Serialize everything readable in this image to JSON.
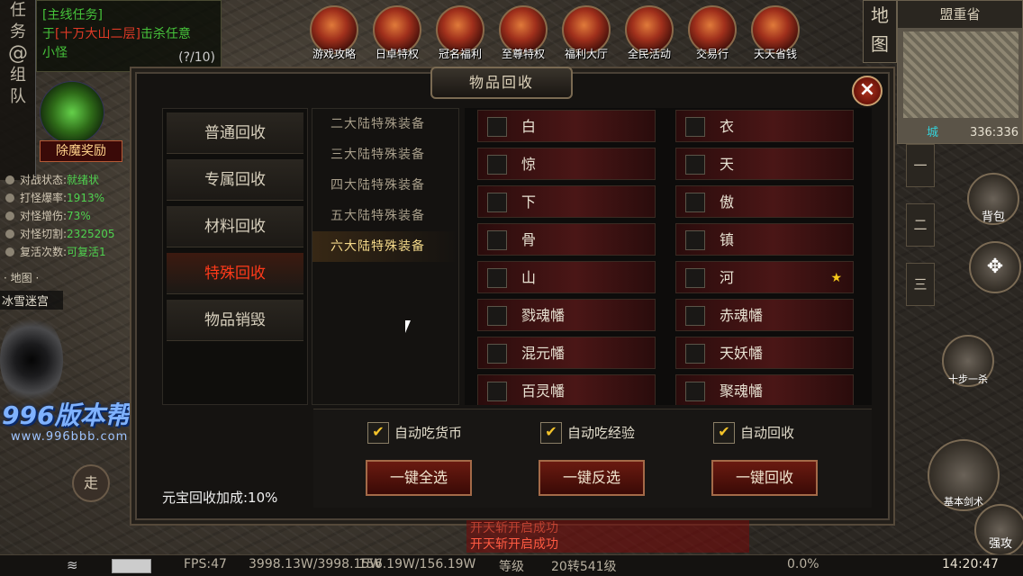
{
  "quest": {
    "header": "[主线任务]",
    "line1_prefix": "于",
    "line1_location": "[十万大山二层]",
    "line1_suffix": "击杀任意",
    "line2": "小怪",
    "progress": "(?/10)",
    "reward_button": "除魔奖励"
  },
  "left_tabs": [
    "任",
    "务",
    "组",
    "队"
  ],
  "stats": [
    {
      "label": "对战状态:",
      "value": "就绪状"
    },
    {
      "label": "打怪爆率:",
      "value": "1913%"
    },
    {
      "label": "对怪增伤:",
      "value": "73%"
    },
    {
      "label": "对怪切割:",
      "value": "2325205"
    },
    {
      "label": "复活次数:",
      "value": "可复活1"
    }
  ],
  "map_marker": "· 地图 ·",
  "map_name": "冰雪迷宫",
  "watermark": {
    "brand": "996版本帮",
    "url": "www.996bbb.com"
  },
  "walk_button": "走",
  "top_icons": [
    "游戏攻略",
    "日卓特权",
    "冠名福利",
    "至尊特权",
    "福利大厅",
    "全民活动",
    "交易行",
    "天天省钱"
  ],
  "minimap": {
    "button": "地图",
    "region": "盟重省",
    "zone": "城",
    "coords": "336:336"
  },
  "right_tabs": [
    "一",
    "二",
    "三"
  ],
  "right_buttons": {
    "bag": "背包",
    "skill": "基本剑术",
    "strong": "强攻",
    "step": "十步一杀"
  },
  "panel": {
    "title": "物品回收",
    "close": "×",
    "categories": [
      "普通回收",
      "专属回收",
      "材料回收",
      "特殊回收",
      "物品销毁"
    ],
    "active_category": "特殊回收",
    "subcategories": [
      "二大陆特殊装备",
      "三大陆特殊装备",
      "四大陆特殊装备",
      "五大陆特殊装备",
      "六大陆特殊装备"
    ],
    "active_sub": "六大陆特殊装备",
    "items_left": [
      "白",
      "惊",
      "下",
      "骨",
      "山",
      "戮魂幡",
      "混元幡",
      "百灵幡"
    ],
    "items_right": [
      "衣",
      "天",
      "傲",
      "镇",
      "河",
      "赤魂幡",
      "天妖幡",
      "聚魂幡"
    ],
    "starred_item": "河",
    "checks": [
      "自动吃货币",
      "自动吃经验",
      "自动回收"
    ],
    "buttons": [
      "一键全选",
      "一键反选",
      "一键回收"
    ],
    "bonus": "元宝回收加成:10%"
  },
  "chat": {
    "line1": "开天斩开启成功",
    "line2": "开天斩开启成功"
  },
  "statusbar": {
    "fps": "FPS:47",
    "hp": "3998.13W/3998.15W",
    "mp": "156.19W/156.19W",
    "level_label": "等级",
    "level": "20转541级",
    "exp": "0.0%",
    "time": "14:20:47"
  },
  "colors": {
    "accent_red": "#ff3a1a",
    "check_gold": "#f4c42a",
    "quest_green": "#46c23a"
  }
}
